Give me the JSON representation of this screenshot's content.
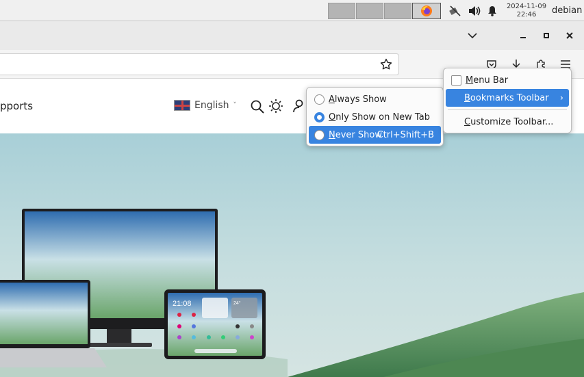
{
  "panel": {
    "clock_date": "2024-11-09",
    "clock_time": "22:46",
    "user": "debian"
  },
  "site": {
    "nav_text": "pports",
    "language": "English",
    "language_caret": "˅"
  },
  "submenu": {
    "items": [
      {
        "label": "Always Show",
        "mnemonic": "A",
        "rest": "lways Show",
        "selected": false
      },
      {
        "label": "Only Show on New Tab",
        "mnemonic": "O",
        "rest": "nly Show on New Tab",
        "selected": true
      },
      {
        "label": "Never Show",
        "mnemonic": "N",
        "rest": "ever Show",
        "accel": "Ctrl+Shift+B",
        "selected": false
      }
    ]
  },
  "toolbar_menu": {
    "menu_bar": {
      "mnemonic": "M",
      "rest": "enu Bar"
    },
    "bookmarks_toolbar": {
      "mnemonic": "B",
      "rest": "ookmarks Toolbar",
      "arrow": "›"
    },
    "customize": {
      "mnemonic": "C",
      "rest": "ustomize Toolbar..."
    }
  },
  "tablet": {
    "time": "21:08",
    "temp": "24°"
  },
  "colors": {
    "accent": "#3884e0",
    "hero_sky": "#a8cfd7",
    "hills": "#5f9a63"
  }
}
